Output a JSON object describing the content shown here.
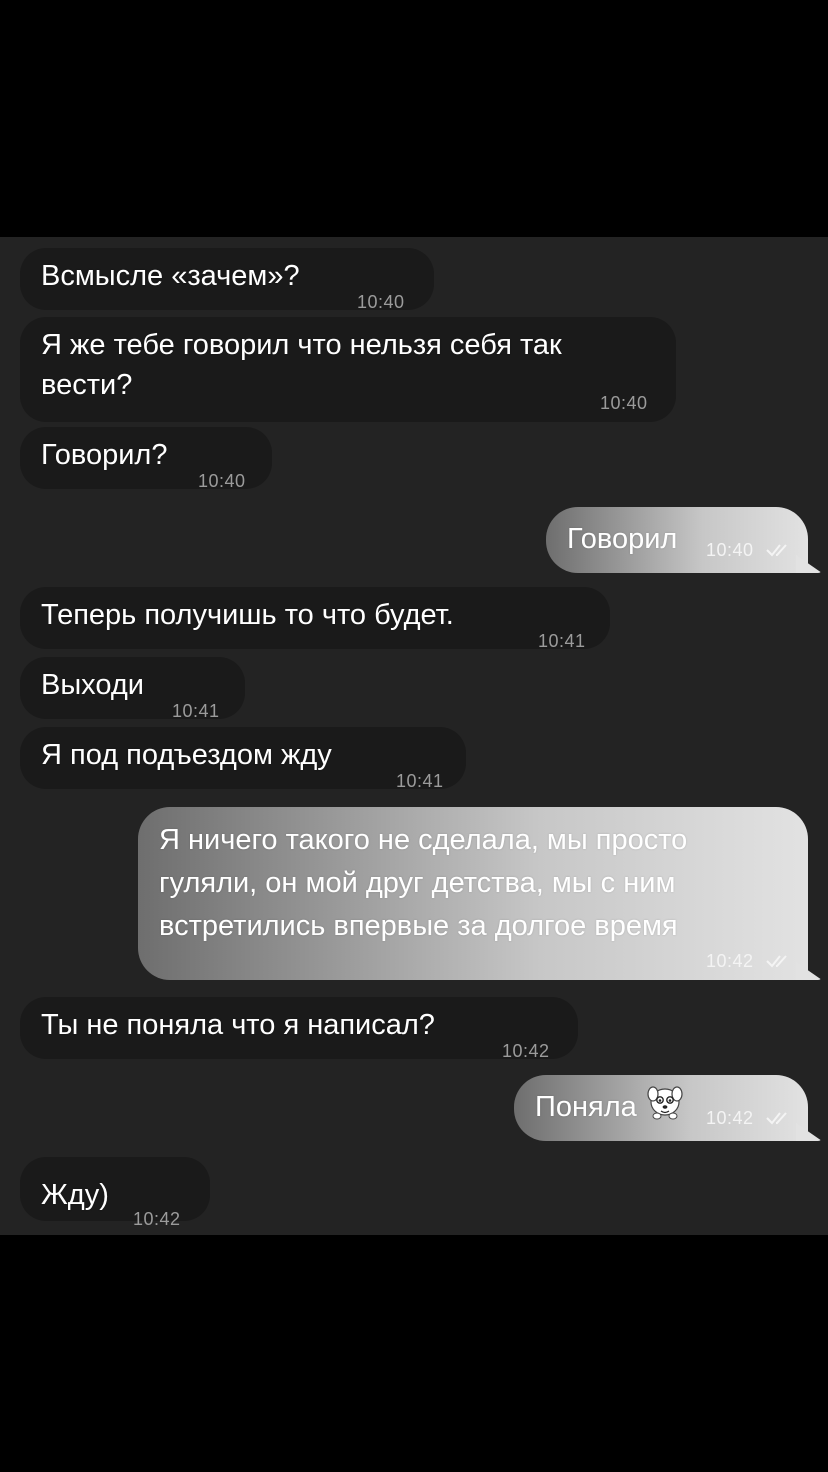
{
  "messages": [
    {
      "side": "in",
      "text": "Всмысле «зачем»?",
      "time": "10:40"
    },
    {
      "side": "in",
      "text": "Я же тебе говорил что нельзя себя так\nвести?",
      "time": "10:40"
    },
    {
      "side": "in",
      "text": "Говорил?",
      "time": "10:40"
    },
    {
      "side": "out",
      "text": "Говорил",
      "time": "10:40",
      "status": "read"
    },
    {
      "side": "in",
      "text": "Теперь получишь то что будет.",
      "time": "10:41"
    },
    {
      "side": "in",
      "text": "Выходи",
      "time": "10:41"
    },
    {
      "side": "in",
      "text": "Я под подъездом жду",
      "time": "10:41"
    },
    {
      "side": "out",
      "text": "Я ничего такого не сделала, мы просто\nгуляли, он мой друг детства, мы с ним\nвстретились впервые за долгое время",
      "time": "10:42",
      "status": "read"
    },
    {
      "side": "in",
      "text": "Ты не поняла что я написал?",
      "time": "10:42"
    },
    {
      "side": "out",
      "text": "Поняла",
      "emoji": "puppy-sticker-icon",
      "time": "10:42",
      "status": "read"
    },
    {
      "side": "in",
      "text": "Жду)",
      "time": "10:42"
    }
  ],
  "colors": {
    "background": "#000000",
    "chat_background": "#232323",
    "incoming_bubble": "#1a1a1a",
    "outgoing_bubble_gradient": [
      "#6e6e6e",
      "#e2e2e2"
    ]
  }
}
